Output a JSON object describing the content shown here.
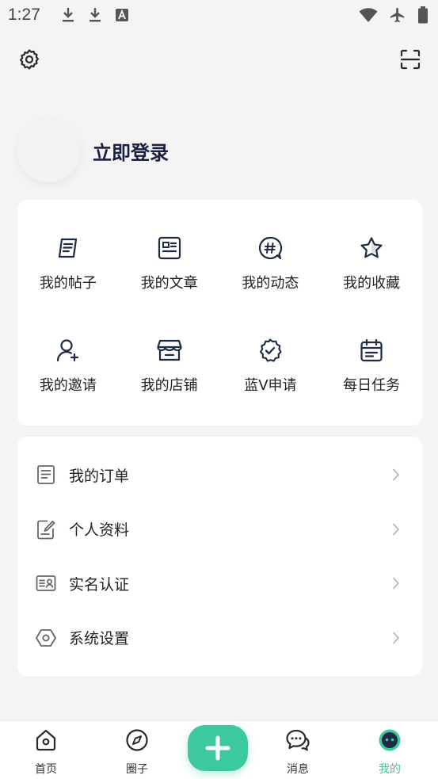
{
  "status_bar": {
    "time": "1:27"
  },
  "header": {
    "settings_icon": "gear-icon",
    "scan_icon": "scan-icon"
  },
  "profile": {
    "login_text": "立即登录"
  },
  "grid": [
    {
      "label": "我的帖子",
      "icon": "post-icon"
    },
    {
      "label": "我的文章",
      "icon": "article-icon"
    },
    {
      "label": "我的动态",
      "icon": "hashtag-icon"
    },
    {
      "label": "我的收藏",
      "icon": "star-icon"
    },
    {
      "label": "我的邀请",
      "icon": "invite-user-icon"
    },
    {
      "label": "我的店铺",
      "icon": "store-icon"
    },
    {
      "label": "蓝V申请",
      "icon": "verified-badge-icon"
    },
    {
      "label": "每日任务",
      "icon": "calendar-task-icon"
    }
  ],
  "list": [
    {
      "label": "我的订单",
      "icon": "order-icon"
    },
    {
      "label": "个人资料",
      "icon": "edit-profile-icon"
    },
    {
      "label": "实名认证",
      "icon": "id-card-icon"
    },
    {
      "label": "系统设置",
      "icon": "hexagon-settings-icon"
    }
  ],
  "bottom_nav": [
    {
      "label": "首页",
      "icon": "home-icon"
    },
    {
      "label": "圈子",
      "icon": "compass-icon"
    },
    {
      "label": "消息",
      "icon": "message-icon"
    },
    {
      "label": "我的",
      "icon": "profile-face-icon",
      "active": true
    }
  ],
  "colors": {
    "accent": "#3cc9a0",
    "title": "#1a2140",
    "background": "#f4f4f4"
  }
}
